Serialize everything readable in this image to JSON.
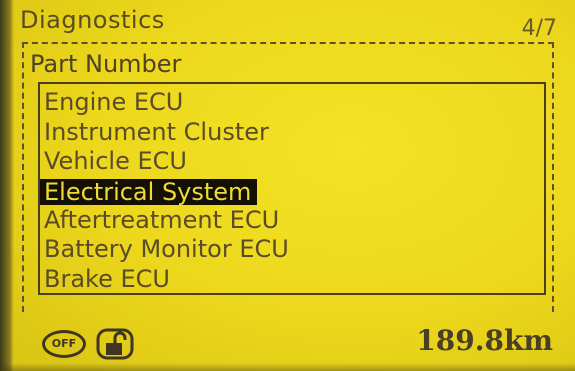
{
  "header": {
    "title": "Diagnostics",
    "page_indicator": "4/7"
  },
  "section": {
    "subheader": "Part Number"
  },
  "menu": {
    "items": [
      {
        "label": "Engine ECU",
        "selected": false
      },
      {
        "label": "Instrument Cluster",
        "selected": false
      },
      {
        "label": "Vehicle ECU",
        "selected": false
      },
      {
        "label": "Electrical System",
        "selected": true
      },
      {
        "label": "Aftertreatment ECU",
        "selected": false
      },
      {
        "label": "Battery Monitor ECU",
        "selected": false
      },
      {
        "label": "Brake ECU",
        "selected": false
      }
    ]
  },
  "status": {
    "off_label": "OFF",
    "odometer": "189.8km",
    "icons": [
      "off-indicator-icon",
      "unlocked-padlock-icon"
    ]
  },
  "colors": {
    "screen": "#e9d21a",
    "text": "#5a4c26",
    "highlight_bg": "#141006",
    "highlight_text": "#f0dc30"
  }
}
